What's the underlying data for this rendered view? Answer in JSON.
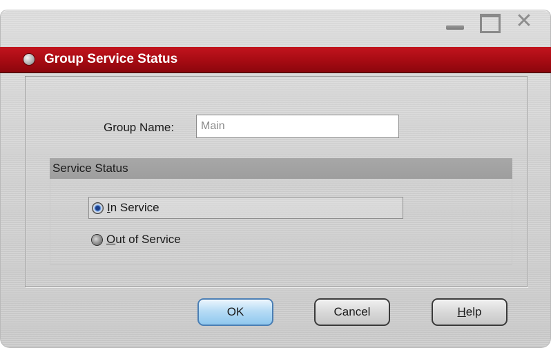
{
  "window": {
    "title": "Group Service Status",
    "controls": {
      "minimize_icon": "minimize-icon",
      "maximize_icon": "maximize-icon",
      "close_icon": "close-icon"
    },
    "accent_color": "#a40a12"
  },
  "form": {
    "group_name_label": "Group Name:",
    "group_name_value": "Main"
  },
  "service_status": {
    "header": "Service Status",
    "options": [
      {
        "label_first": "I",
        "label_rest": "n Service",
        "selected": true
      },
      {
        "label_first": "O",
        "label_rest": "ut of Service",
        "selected": false
      }
    ]
  },
  "buttons": {
    "ok": "OK",
    "cancel": "Cancel",
    "help_first": "H",
    "help_rest": "elp"
  }
}
